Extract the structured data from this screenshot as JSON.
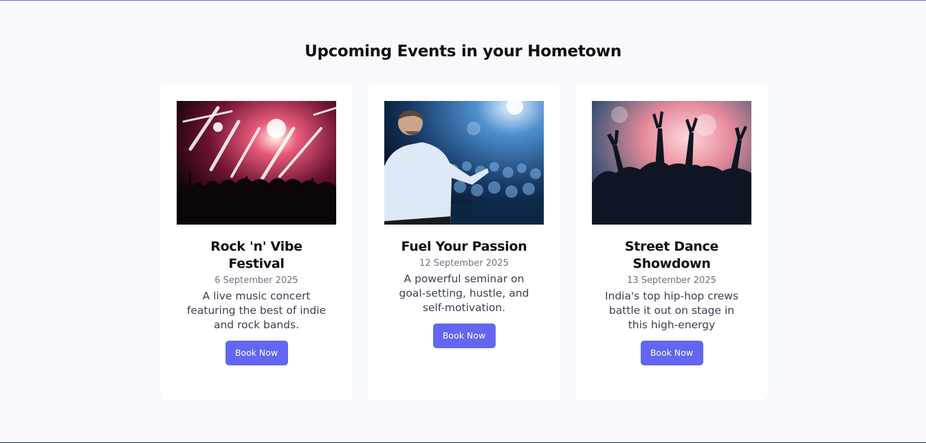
{
  "page": {
    "title": "Upcoming Events in your Hometown"
  },
  "events": [
    {
      "title": "Rock 'n' Vibe Festival",
      "date": "6 September 2025",
      "description": "A live music concert featuring the best of indie and rock bands.",
      "button_label": "Book Now",
      "image": "concert-crowd-stage-lights-photo"
    },
    {
      "title": "Fuel Your Passion",
      "date": "12 September 2025",
      "description": "A powerful seminar on goal-setting, hustle, and self-motivation.",
      "button_label": "Book Now",
      "image": "speaker-addressing-audience-photo"
    },
    {
      "title": "Street Dance Showdown",
      "date": "13 September 2025",
      "description": "India's top hip-hop crews battle it out on stage in this high-energy",
      "button_label": "Book Now",
      "image": "dance-party-crowd-photo"
    }
  ],
  "colors": {
    "accent": "#6366f1",
    "background": "#f8f9fc",
    "card": "#ffffff",
    "text_dark": "#111111",
    "text_muted": "#6b7280"
  }
}
